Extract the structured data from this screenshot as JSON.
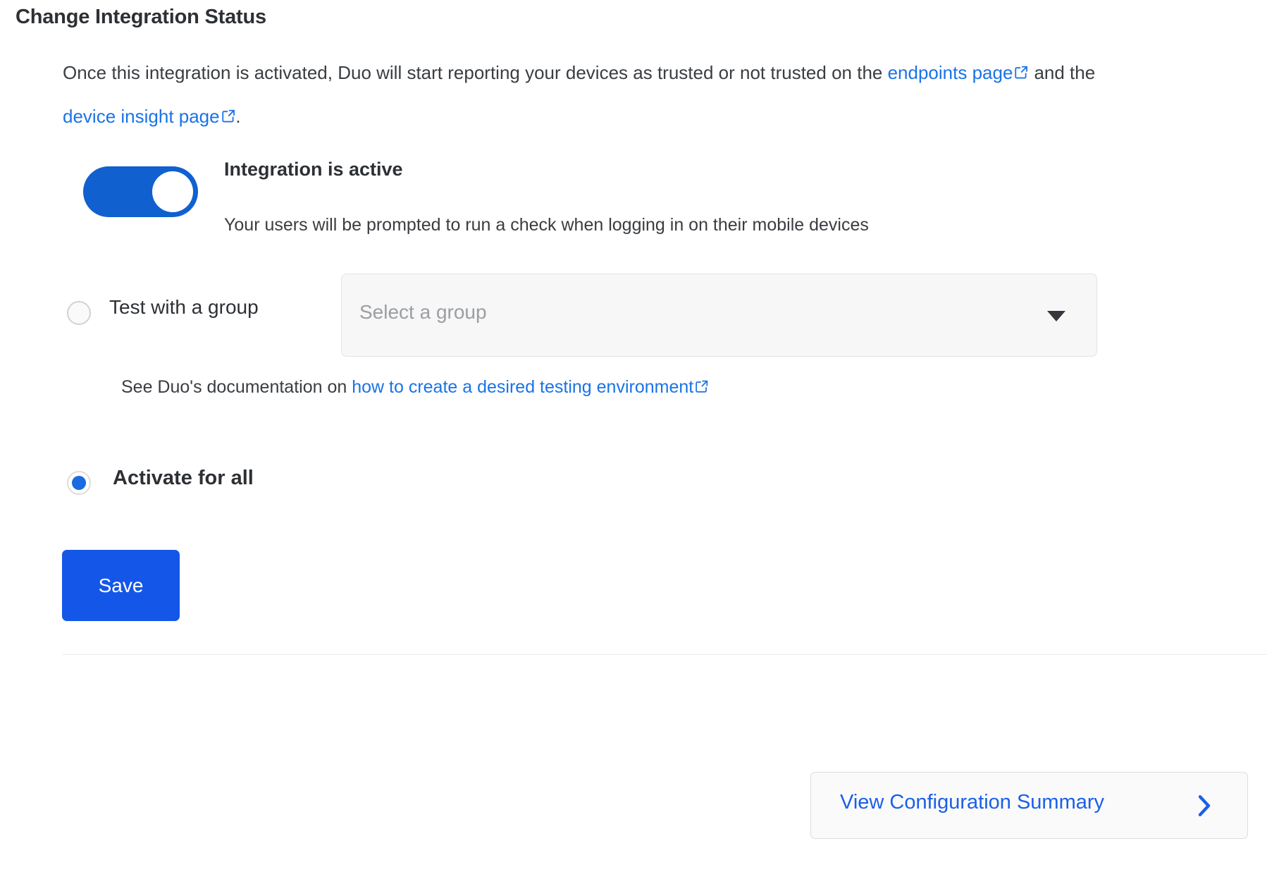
{
  "section": {
    "title": "Change Integration Status",
    "intro": {
      "part1": "Once this integration is activated, Duo will start reporting your devices as trusted or not trusted on the ",
      "link1": "endpoints page",
      "part2": " and the ",
      "link2": "device insight page",
      "part3": "."
    }
  },
  "toggle": {
    "state": "on",
    "title": "Integration is active",
    "subtitle": "Your users will be prompted to run a check when logging in on their mobile devices"
  },
  "test_group": {
    "radio_label": "Test with a group",
    "radio_selected": false,
    "dropdown_placeholder": "Select a group",
    "dropdown_value": "Select a group",
    "caret_icon": "chevron-down-icon"
  },
  "docs": {
    "prefix": "See Duo's documentation on ",
    "link": "how to create a desired testing environment"
  },
  "activate_all": {
    "radio_label": "Activate for all",
    "radio_selected": true
  },
  "actions": {
    "save_label": "Save"
  },
  "footer": {
    "summary_label": "View Configuration Summary",
    "chevron_icon": "chevron-right-icon"
  },
  "colors": {
    "accent_blue": "#1457e8",
    "link_blue": "#1a73e8",
    "toggle_on": "#1060cf",
    "radio_blue": "#1b6ae0",
    "text": "#2d3034"
  },
  "icons": {
    "external_link": "external-link-icon"
  }
}
